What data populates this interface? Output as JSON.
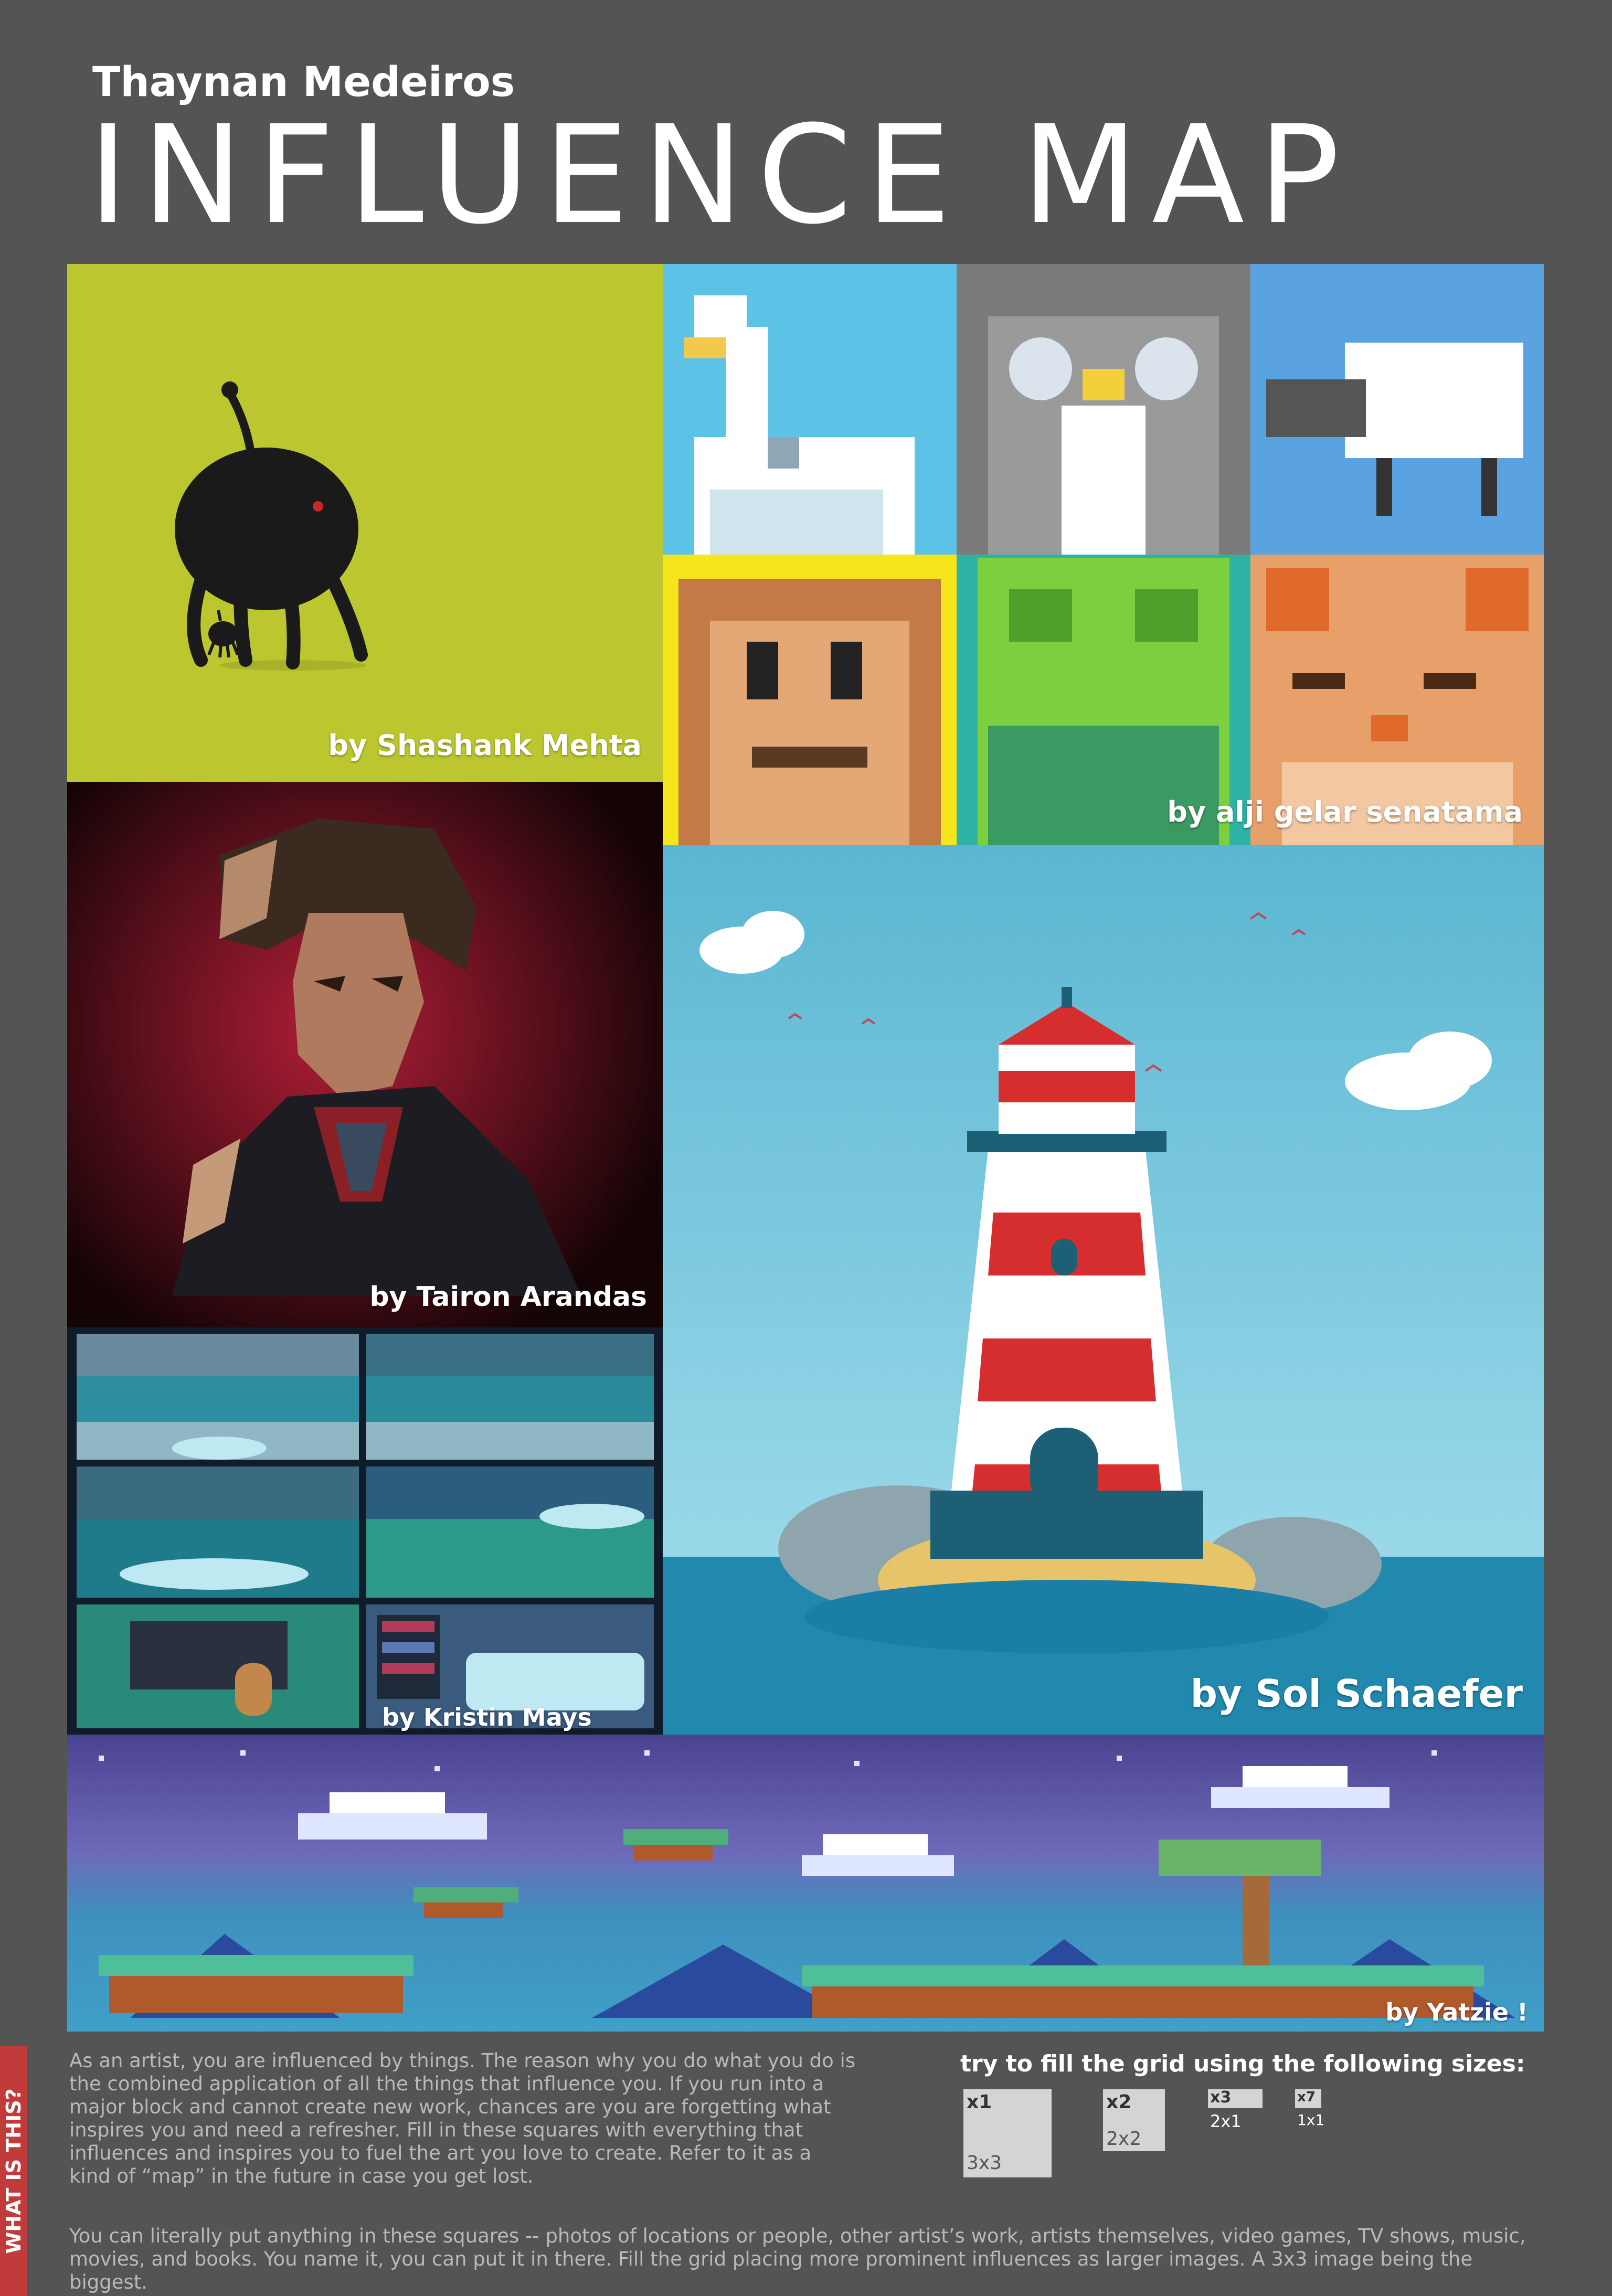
{
  "header": {
    "author": "Thaynan Medeiros",
    "title": "INFLUENCE MAP"
  },
  "tiles": {
    "creature": {
      "credit": "by Shashank Mehta"
    },
    "pixel_animals": {
      "credit": "by alji gelar senatama"
    },
    "portrait": {
      "credit": "by Tairon Arandas"
    },
    "lighthouse": {
      "credit": "by Sol Schaefer"
    },
    "forest": {
      "credit": "by Kristin Mays"
    },
    "pixel_landscape": {
      "credit": "by Yatzie !"
    }
  },
  "footer": {
    "label": "WHAT IS THIS?",
    "paragraph1": "As an artist, you are influenced by things. The reason why you do what you do is the combined application of all the things that influence you. If you run into a major block and cannot create new work, chances are you are forgetting what inspires you and need a refresher. Fill in these squares with everything that influences and inspires you to fuel the art you love to create. Refer to it as a kind of “map” in the future in case you get lost.",
    "paragraph2": "You can literally put anything in these squares -- photos of locations or people, other artist’s work, artists themselves, video games, TV shows, music, movies, and books. You name it, you can put it in there. Fill the grid placing more prominent influences as larger images. A 3x3 image being the biggest.",
    "grid_heading": "try to fill the grid using the following sizes:",
    "sizes": [
      {
        "count": "x1",
        "size": "3x3"
      },
      {
        "count": "x2",
        "size": "2x2"
      },
      {
        "count": "x3",
        "size": "2x1"
      },
      {
        "count": "x7",
        "size": "1x1"
      }
    ]
  }
}
